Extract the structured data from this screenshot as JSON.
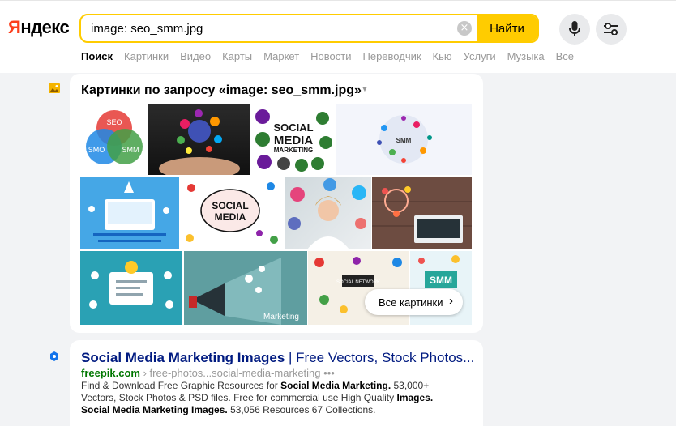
{
  "header": {
    "logo": "Яндекс",
    "search_value": "image: seo_smm.jpg",
    "search_button": "Найти",
    "clear_icon": "×"
  },
  "nav": {
    "items": [
      "Поиск",
      "Картинки",
      "Видео",
      "Карты",
      "Маркет",
      "Новости",
      "Переводчик",
      "Кью",
      "Услуги",
      "Музыка",
      "Все"
    ]
  },
  "images": {
    "title": "Картинки по запросу «image: seo_smm.jpg»",
    "all_images": "Все картинки",
    "venn": {
      "a": "SEO",
      "b": "SMO",
      "c": "SMM"
    },
    "social_text_1": "SOCIAL",
    "social_text_2": "MEDIA",
    "social_text_3": "MARKETING",
    "smm_label": "SMM",
    "social_media_sign_1": "SOCIAL",
    "social_media_sign_2": "MEDIA",
    "marketing_label": "Marketing",
    "social_network": "SOCIAL NETWORK",
    "smm_tile": "SMM"
  },
  "result": {
    "title": "Social Media Marketing Images",
    "title_rest": " | Free Vectors, Stock Photos...",
    "domain": "freepik.com",
    "path": " › free-photos...social-media-marketing",
    "more": "•••",
    "snippet_1": "Find & Download Free Graphic Resources for ",
    "snippet_b1": "Social Media Marketing.",
    "snippet_2": " 53,000+ Vectors, Stock Photos & PSD files. Free for commercial use High Quality ",
    "snippet_b2": "Images.",
    "snippet_3": " ",
    "snippet_b3": "Social Media Marketing Images.",
    "snippet_4": " 53,056 Resources 67 Collections."
  }
}
